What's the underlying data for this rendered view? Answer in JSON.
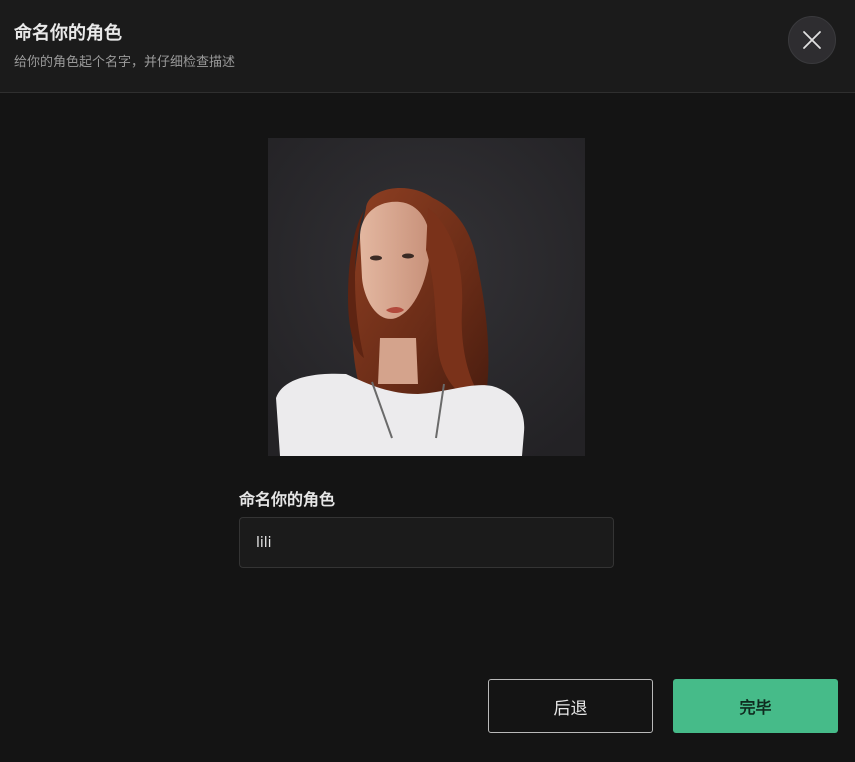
{
  "header": {
    "title": "命名你的角色",
    "subtitle": "给你的角色起个名字，并仔细检查描述"
  },
  "portrait": {
    "icon": "character-portrait"
  },
  "form": {
    "label": "命名你的角色",
    "name_value": "lili"
  },
  "footer": {
    "back_label": "后退",
    "done_label": "完毕"
  },
  "colors": {
    "background": "#141414",
    "header_bg": "#1b1b1b",
    "accent": "#46bb89"
  }
}
